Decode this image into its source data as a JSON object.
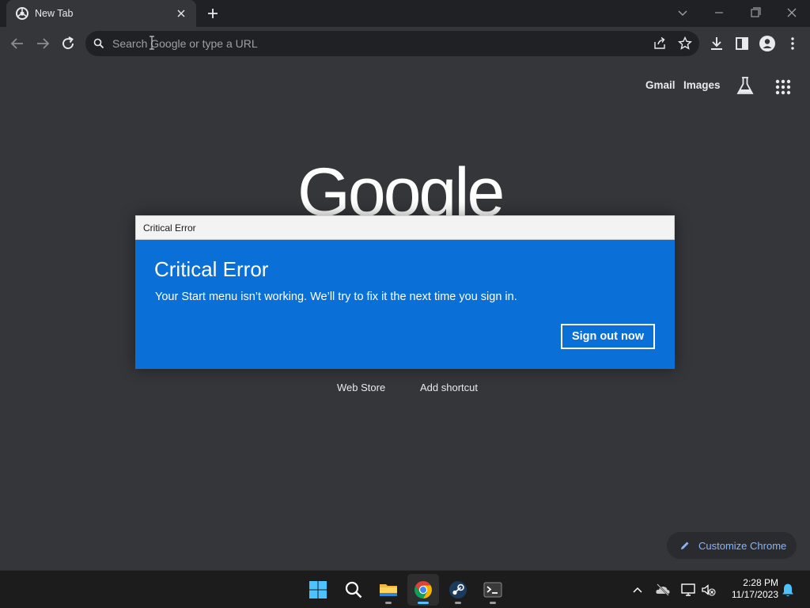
{
  "browser": {
    "tab": {
      "title": "New Tab"
    },
    "omnibox": {
      "placeholder": "Search Google or type a URL"
    }
  },
  "page": {
    "top_links": [
      "Gmail",
      "Images"
    ],
    "logo_text": "Google",
    "shortcuts": [
      "Web Store",
      "Add shortcut"
    ],
    "customize_label": "Customize Chrome"
  },
  "dialog": {
    "window_title": "Critical Error",
    "heading": "Critical Error",
    "message": "Your Start menu isn’t working. We’ll try to fix it the next time you sign in.",
    "button_label": "Sign out now"
  },
  "taskbar": {
    "apps": [
      "start-icon",
      "search-icon",
      "file-explorer-icon",
      "chrome-icon",
      "steam-icon",
      "terminal-icon"
    ],
    "clock_time": "2:28 PM",
    "clock_date": "11/17/2023"
  },
  "colors": {
    "dialog_body": "#0a6fd6",
    "page_bg": "#35363a",
    "tabstrip_bg": "#202124",
    "link_blue": "#8ab4f8"
  }
}
